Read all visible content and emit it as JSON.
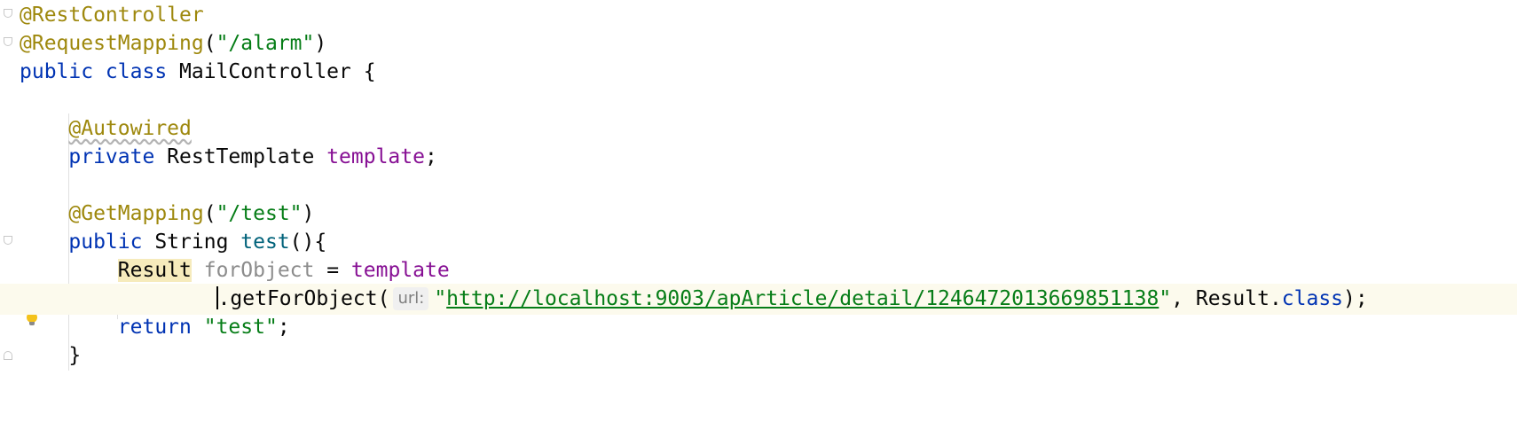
{
  "editor": {
    "lines": [
      {
        "tokens": [
          {
            "t": "@RestController",
            "c": "ann"
          }
        ]
      },
      {
        "tokens": [
          {
            "t": "@RequestMapping",
            "c": "ann"
          },
          {
            "t": "(",
            "c": ""
          },
          {
            "t": "\"/alarm\"",
            "c": "str"
          },
          {
            "t": ")",
            "c": ""
          }
        ]
      },
      {
        "tokens": [
          {
            "t": "public class ",
            "c": "kw"
          },
          {
            "t": "MailController {",
            "c": ""
          }
        ]
      },
      {
        "tokens": []
      },
      {
        "tokens": [
          {
            "t": "    ",
            "c": ""
          },
          {
            "t": "@Autowired",
            "c": "ann squig"
          }
        ]
      },
      {
        "tokens": [
          {
            "t": "    ",
            "c": ""
          },
          {
            "t": "private ",
            "c": "kw"
          },
          {
            "t": "RestTemplate ",
            "c": ""
          },
          {
            "t": "template",
            "c": "field"
          },
          {
            "t": ";",
            "c": ""
          }
        ]
      },
      {
        "tokens": []
      },
      {
        "tokens": [
          {
            "t": "    ",
            "c": ""
          },
          {
            "t": "@GetMapping",
            "c": "ann"
          },
          {
            "t": "(",
            "c": ""
          },
          {
            "t": "\"/test\"",
            "c": "str"
          },
          {
            "t": ")",
            "c": ""
          }
        ]
      },
      {
        "tokens": [
          {
            "t": "    ",
            "c": ""
          },
          {
            "t": "public ",
            "c": "kw"
          },
          {
            "t": "String ",
            "c": ""
          },
          {
            "t": "test",
            "c": "fn"
          },
          {
            "t": "(){",
            "c": ""
          }
        ]
      },
      {
        "tokens": [
          {
            "t": "        ",
            "c": ""
          },
          {
            "t": "Result",
            "c": "hl"
          },
          {
            "t": " ",
            "c": ""
          },
          {
            "t": "forObject",
            "c": "unused"
          },
          {
            "t": " = ",
            "c": ""
          },
          {
            "t": "template",
            "c": "field"
          }
        ]
      },
      {
        "current": true,
        "tokens": [
          {
            "t": "                ",
            "c": ""
          },
          {
            "caret": true
          },
          {
            "t": ".getForObject(",
            "c": ""
          },
          {
            "hint": "url:"
          },
          {
            "t": "\"",
            "c": "str"
          },
          {
            "t": "http://localhost:9003/apArticle/detail/1246472013669851138",
            "c": "link"
          },
          {
            "t": "\"",
            "c": "str"
          },
          {
            "t": ", Result.",
            "c": ""
          },
          {
            "t": "class",
            "c": "kw"
          },
          {
            "t": ");",
            "c": ""
          }
        ]
      },
      {
        "tokens": [
          {
            "t": "        ",
            "c": ""
          },
          {
            "t": "return ",
            "c": "kw"
          },
          {
            "t": "\"test\"",
            "c": "str"
          },
          {
            "t": ";",
            "c": ""
          }
        ]
      },
      {
        "tokens": [
          {
            "t": "    }",
            "c": ""
          }
        ]
      }
    ]
  }
}
